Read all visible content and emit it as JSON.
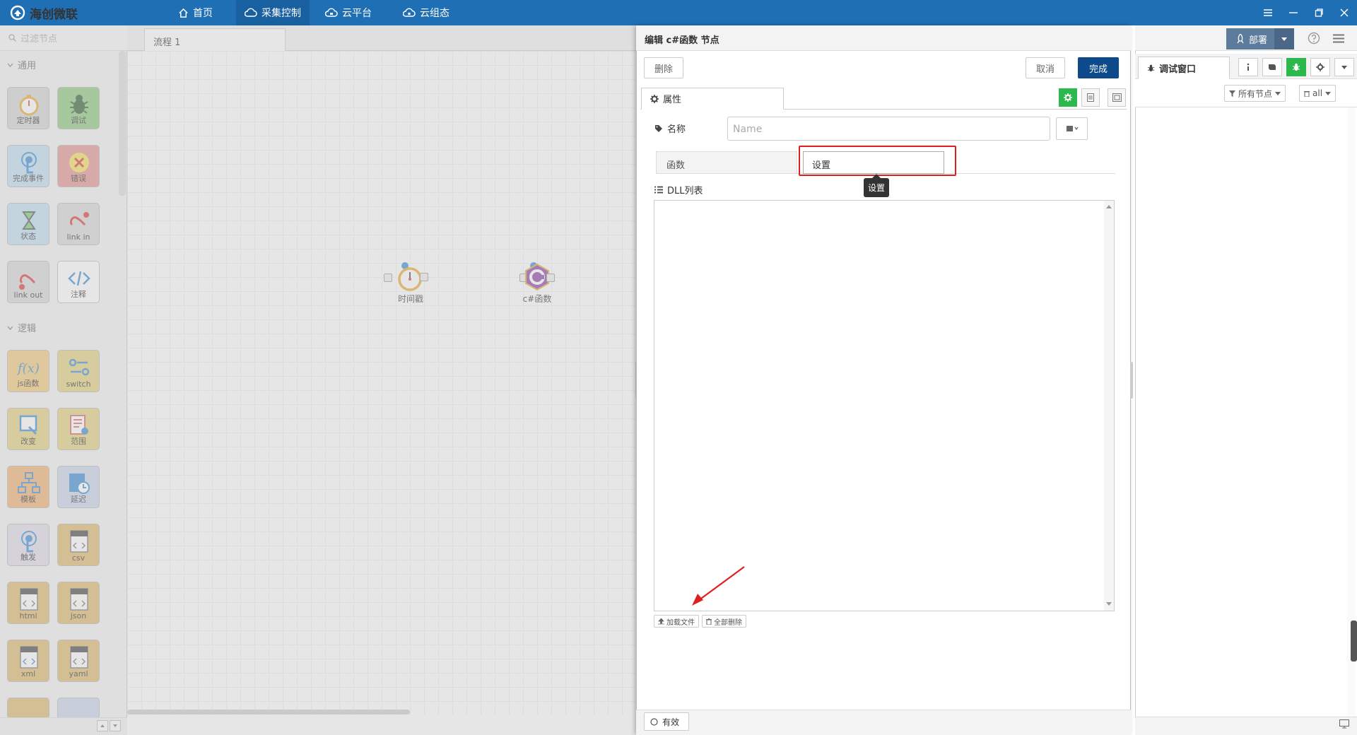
{
  "app": {
    "brand": "海创微联",
    "accent": "#1f6fb5"
  },
  "nav": [
    {
      "label": "首页",
      "icon": "home-icon"
    },
    {
      "label": "采集控制",
      "icon": "cloud-control-icon"
    },
    {
      "label": "云平台",
      "icon": "cloud-platform-icon"
    },
    {
      "label": "云组态",
      "icon": "cloud-config-icon"
    }
  ],
  "palette": {
    "filter_placeholder": "过滤节点",
    "categories": [
      "通用",
      "逻辑"
    ],
    "nodes": [
      {
        "label": "定时器",
        "color": "#d3d3d3"
      },
      {
        "label": "调试",
        "color": "#8cc87c"
      },
      {
        "label": "完成事件",
        "color": "#c0def2"
      },
      {
        "label": "错误",
        "color": "#e69090"
      },
      {
        "label": "状态",
        "color": "#c0def2"
      },
      {
        "label": "link in",
        "color": "#d8d8d8"
      },
      {
        "label": "link out",
        "color": "#d8d8d8"
      },
      {
        "label": "注释",
        "color": "#ffffff"
      },
      {
        "label": "js函数",
        "color": "#f0c878"
      },
      {
        "label": "switch",
        "color": "#e4d07a"
      },
      {
        "label": "改变",
        "color": "#e4d07a"
      },
      {
        "label": "范围",
        "color": "#e4d07a"
      },
      {
        "label": "模板",
        "color": "#f0b070"
      },
      {
        "label": "延迟",
        "color": "#c8d4ea"
      },
      {
        "label": "触发",
        "color": "#e0dde8"
      },
      {
        "label": "csv",
        "color": "#dfb96a"
      },
      {
        "label": "html",
        "color": "#dfb96a"
      },
      {
        "label": "json",
        "color": "#dfb96a"
      },
      {
        "label": "xml",
        "color": "#dfb96a"
      },
      {
        "label": "yaml",
        "color": "#dfb96a"
      }
    ]
  },
  "workspace": {
    "tab": "流程 1",
    "nodes": [
      {
        "label": "时间戳"
      },
      {
        "label": "c#函数"
      }
    ]
  },
  "editor": {
    "title": "编辑 c#函数 节点",
    "delete_label": "删除",
    "cancel_label": "取消",
    "done_label": "完成",
    "props_tab": "属性",
    "name_label": "名称",
    "name_placeholder": "Name",
    "func_tabs": [
      "函数",
      "设置"
    ],
    "tooltip": "设置",
    "dll_label": "DLL列表",
    "load_file": "加载文件",
    "delete_all": "全部删除",
    "valid_label": "有效",
    "highlight_color": "#e02020"
  },
  "sidebar": {
    "deploy_label": "部署",
    "debug_tab": "调试窗口",
    "filter_nodes": "所有节点",
    "filter_all": "all"
  }
}
